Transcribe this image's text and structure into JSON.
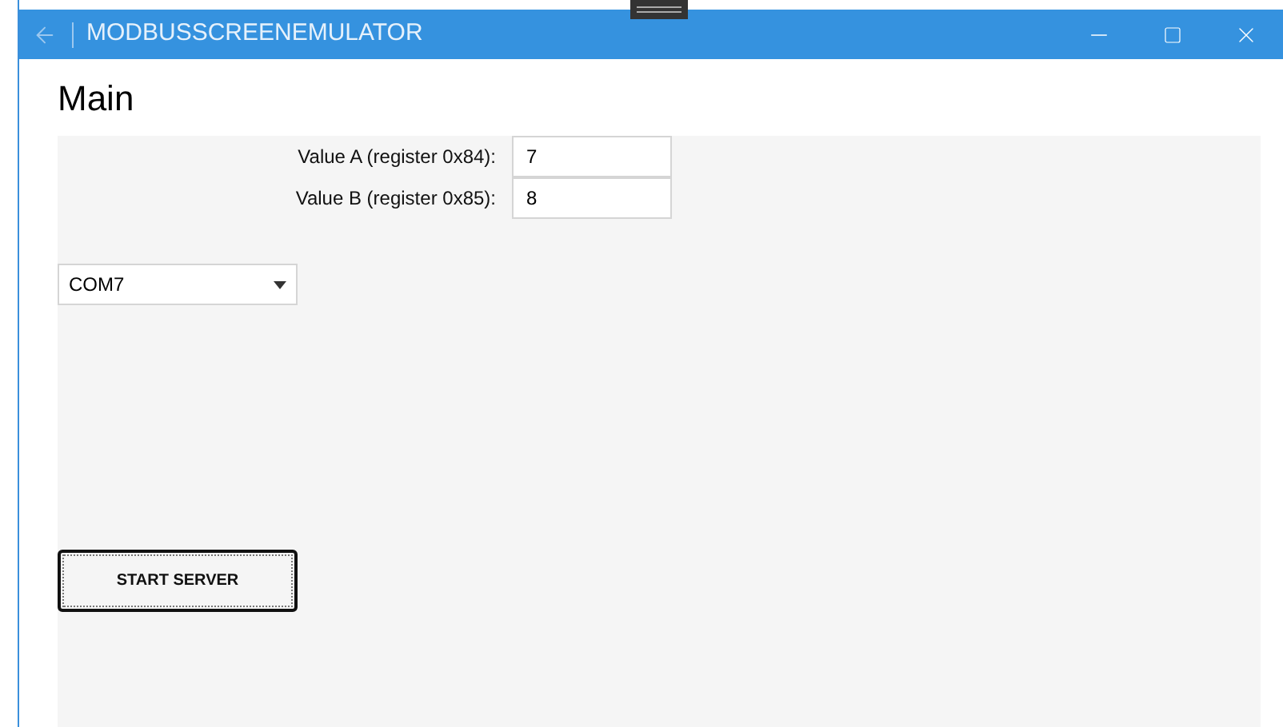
{
  "window": {
    "title": "MODBUSSCREENEMULATOR"
  },
  "page_title": "Main",
  "fields": [
    {
      "label": "Value A (register 0x84):",
      "value": "7"
    },
    {
      "label": "Value B (register 0x85):",
      "value": "8"
    }
  ],
  "port_select": {
    "value": "COM7"
  },
  "start_button": {
    "label": "START SERVER",
    "focused": true
  }
}
